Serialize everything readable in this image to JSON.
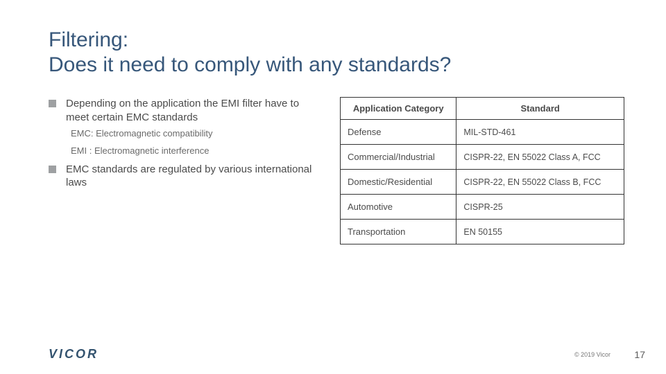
{
  "title": {
    "line1": "Filtering:",
    "line2": "Does it need to comply with any standards?"
  },
  "bullets": {
    "b1": "Depending on the application the EMI filter have to meet certain EMC standards",
    "sub1": "EMC: Electromagnetic compatibility",
    "sub2": "EMI :  Electromagnetic interference",
    "b2": "EMC standards are regulated by various international laws"
  },
  "table": {
    "headers": {
      "c1": "Application Category",
      "c2": "Standard"
    },
    "rows": [
      {
        "cat": "Defense",
        "std": "MIL-STD-461"
      },
      {
        "cat": "Commercial/Industrial",
        "std": "CISPR-22, EN 55022 Class A, FCC"
      },
      {
        "cat": "Domestic/Residential",
        "std": "CISPR-22, EN 55022 Class B, FCC"
      },
      {
        "cat": "Automotive",
        "std": "CISPR-25"
      },
      {
        "cat": "Transportation",
        "std": "EN 50155"
      }
    ]
  },
  "footer": {
    "logo": "VICOR",
    "copyright": "© 2019 Vicor",
    "page": "17"
  }
}
